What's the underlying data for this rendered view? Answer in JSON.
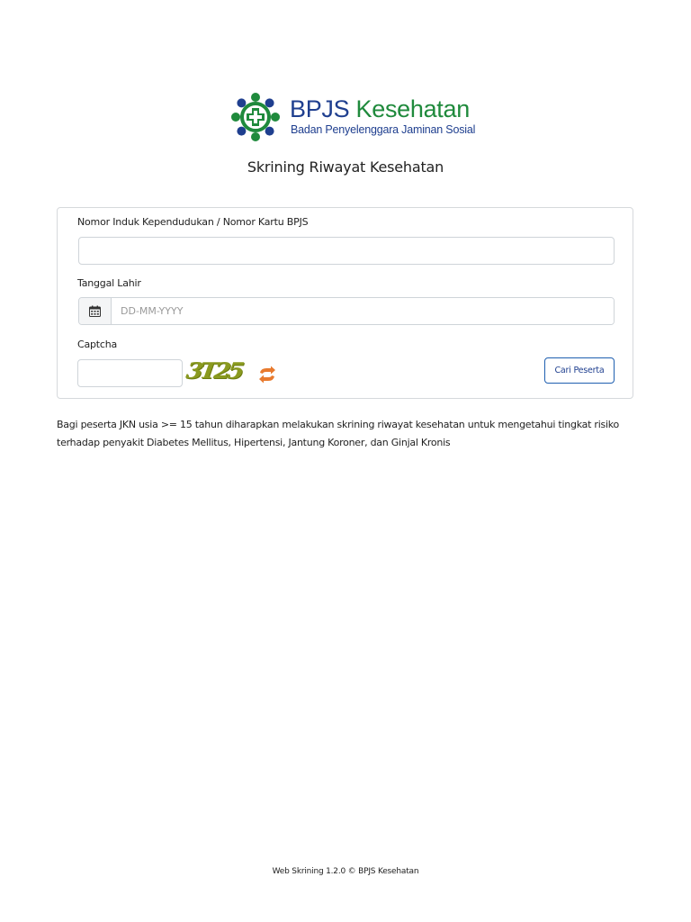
{
  "header": {
    "logo_brand": "BPJS",
    "logo_product": "Kesehatan",
    "logo_subtitle": "Badan Penyelenggara Jaminan Sosial",
    "page_title": "Skrining Riwayat Kesehatan"
  },
  "form": {
    "nik_label": "Nomor Induk Kependudukan / Nomor Kartu BPJS",
    "nik_value": "",
    "dob_label": "Tanggal Lahir",
    "dob_placeholder": "DD-MM-YYYY",
    "dob_value": "",
    "captcha_label": "Captcha",
    "captcha_value": "",
    "captcha_image_text": "3T25",
    "submit_label": "Cari Peserta"
  },
  "info_text": "Bagi peserta JKN usia >= 15 tahun diharapkan melakukan skrining riwayat kesehatan untuk mengetahui tingkat risiko terhadap penyakit Diabetes Mellitus, Hipertensi, Jantung Koroner, dan Ginjal Kronis",
  "footer_text": "Web Skrining 1.2.0 © BPJS Kesehatan",
  "icons": {
    "logo": "bpjs-logo-icon",
    "calendar": "calendar-icon",
    "refresh": "refresh-icon"
  },
  "colors": {
    "brand_blue": "#1f3f8f",
    "brand_green": "#1f8a3c",
    "captcha_olive": "#8a9a1f",
    "refresh_orange": "#e87a2e",
    "button_border": "#1f5fb0"
  }
}
